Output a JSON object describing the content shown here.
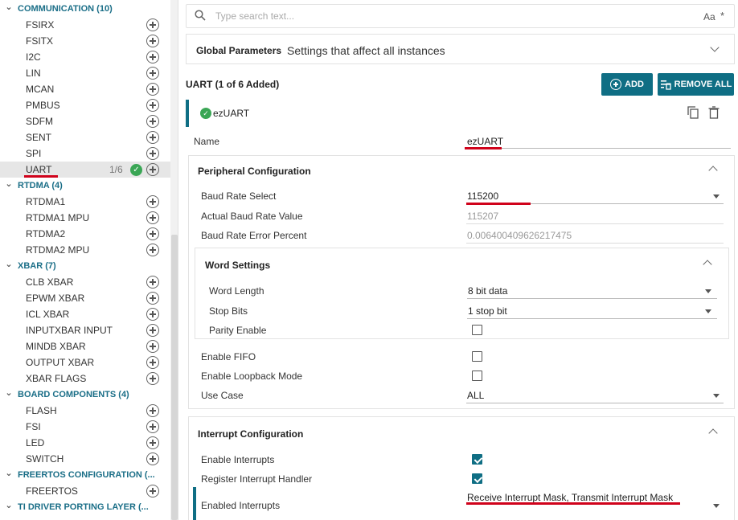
{
  "sidebar": {
    "communication": {
      "label": "COMMUNICATION (10)",
      "items": [
        "FSIRX",
        "FSITX",
        "I2C",
        "LIN",
        "MCAN",
        "PMBUS",
        "SDFM",
        "SENT",
        "SPI",
        "UART"
      ],
      "uart_count": "1/6"
    },
    "rtdma": {
      "label": "RTDMA (4)",
      "items": [
        "RTDMA1",
        "RTDMA1 MPU",
        "RTDMA2",
        "RTDMA2 MPU"
      ]
    },
    "xbar": {
      "label": "XBAR (7)",
      "items": [
        "CLB XBAR",
        "EPWM XBAR",
        "ICL XBAR",
        "INPUTXBAR INPUT",
        "MINDB XBAR",
        "OUTPUT XBAR",
        "XBAR FLAGS"
      ]
    },
    "board": {
      "label": "BOARD COMPONENTS (4)",
      "items": [
        "FLASH",
        "FSI",
        "LED",
        "SWITCH"
      ]
    },
    "freertos": {
      "label": "FREERTOS CONFIGURATION (...",
      "items": [
        "FREERTOS"
      ]
    },
    "tidriver": {
      "label": "TI DRIVER PORTING LAYER (..."
    }
  },
  "search": {
    "placeholder": "Type search text...",
    "case_label": "Aa",
    "regex_label": "*"
  },
  "global": {
    "title": "Global Parameters",
    "description": "Settings that affect all instances"
  },
  "uart": {
    "title": "UART (1 of 6 Added)",
    "add_label": "ADD",
    "remove_label": "REMOVE ALL",
    "instance_name": "ezUART"
  },
  "fields": {
    "name_label": "Name",
    "name_value": "ezUART",
    "peripheral_title": "Peripheral Configuration",
    "baud_select_label": "Baud Rate Select",
    "baud_select_value": "115200",
    "actual_baud_label": "Actual Baud Rate Value",
    "actual_baud_value": "115207",
    "baud_error_label": "Baud Rate Error Percent",
    "baud_error_value": "0.006400409626217475",
    "word_settings_title": "Word Settings",
    "word_length_label": "Word Length",
    "word_length_value": "8 bit data",
    "stop_bits_label": "Stop Bits",
    "stop_bits_value": "1 stop bit",
    "parity_label": "Parity Enable",
    "fifo_label": "Enable FIFO",
    "loopback_label": "Enable Loopback Mode",
    "use_case_label": "Use Case",
    "use_case_value": "ALL",
    "interrupt_title": "Interrupt Configuration",
    "enable_int_label": "Enable Interrupts",
    "register_handler_label": "Register Interrupt Handler",
    "enabled_ints_label": "Enabled Interrupts",
    "enabled_ints_value": "Receive Interrupt Mask, Transmit Interrupt Mask"
  },
  "colors": {
    "accent": "#0f6e84",
    "category": "#1a6e87",
    "ok": "#3aa655",
    "highlight": "#d0021b"
  }
}
